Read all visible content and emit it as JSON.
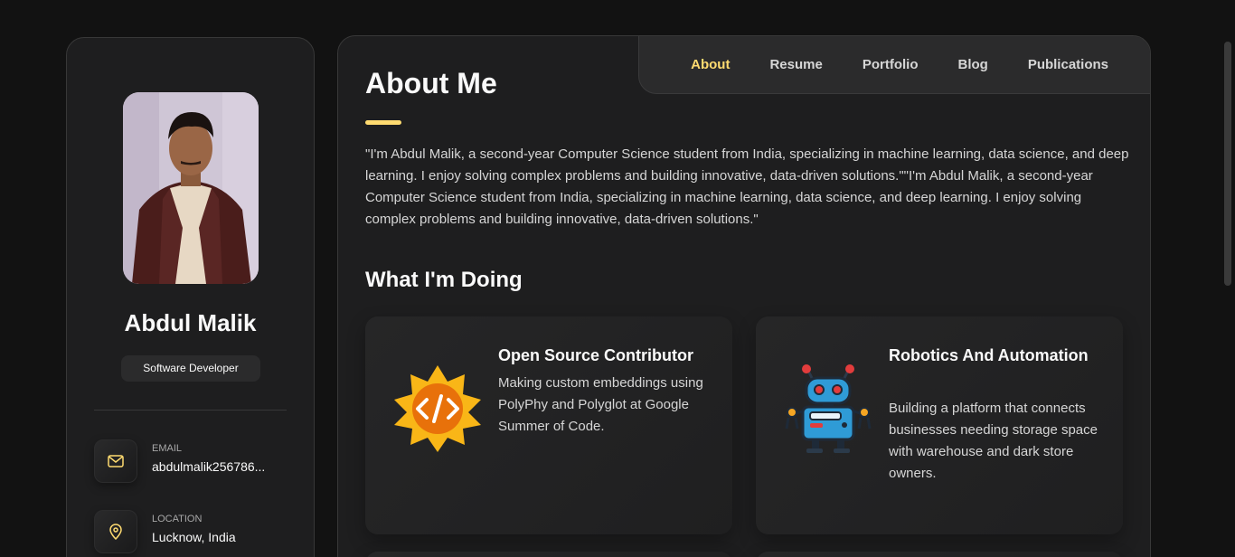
{
  "profile": {
    "name": "Abdul Malik",
    "role": "Software Developer",
    "avatar_icon": "person-photo"
  },
  "contacts": [
    {
      "label": "Email",
      "value": "abdulmalik256786...",
      "icon": "mail-icon"
    },
    {
      "label": "Location",
      "value": "Lucknow, India",
      "icon": "location-pin-icon"
    }
  ],
  "nav": {
    "items": [
      "About",
      "Resume",
      "Portfolio",
      "Blog",
      "Publications"
    ],
    "active": "About"
  },
  "about": {
    "title": "About Me",
    "text": "\"I'm Abdul Malik, a second-year Computer Science student from India, specializing in machine learning, data science, and deep learning. I enjoy solving complex problems and building innovative, data-driven solutions.\"\"I'm Abdul Malik, a second-year Computer Science student from India, specializing in machine learning, data science, and deep learning. I enjoy solving complex problems and building innovative, data-driven solutions.\""
  },
  "services": {
    "title": "What I'm Doing",
    "items": [
      {
        "title": "Open Source Contributor",
        "text": "Making custom embeddings using PolyPhy and Polyglot at Google Summer of Code.",
        "icon": "code-sun-icon"
      },
      {
        "title": "Robotics And Automation",
        "text": "Building a platform that connects businesses needing storage space with warehouse and dark store owners.",
        "icon": "robot-icon"
      }
    ]
  },
  "colors": {
    "accent": "#ffdb70",
    "background": "#121212",
    "panel": "#1e1e1f"
  }
}
